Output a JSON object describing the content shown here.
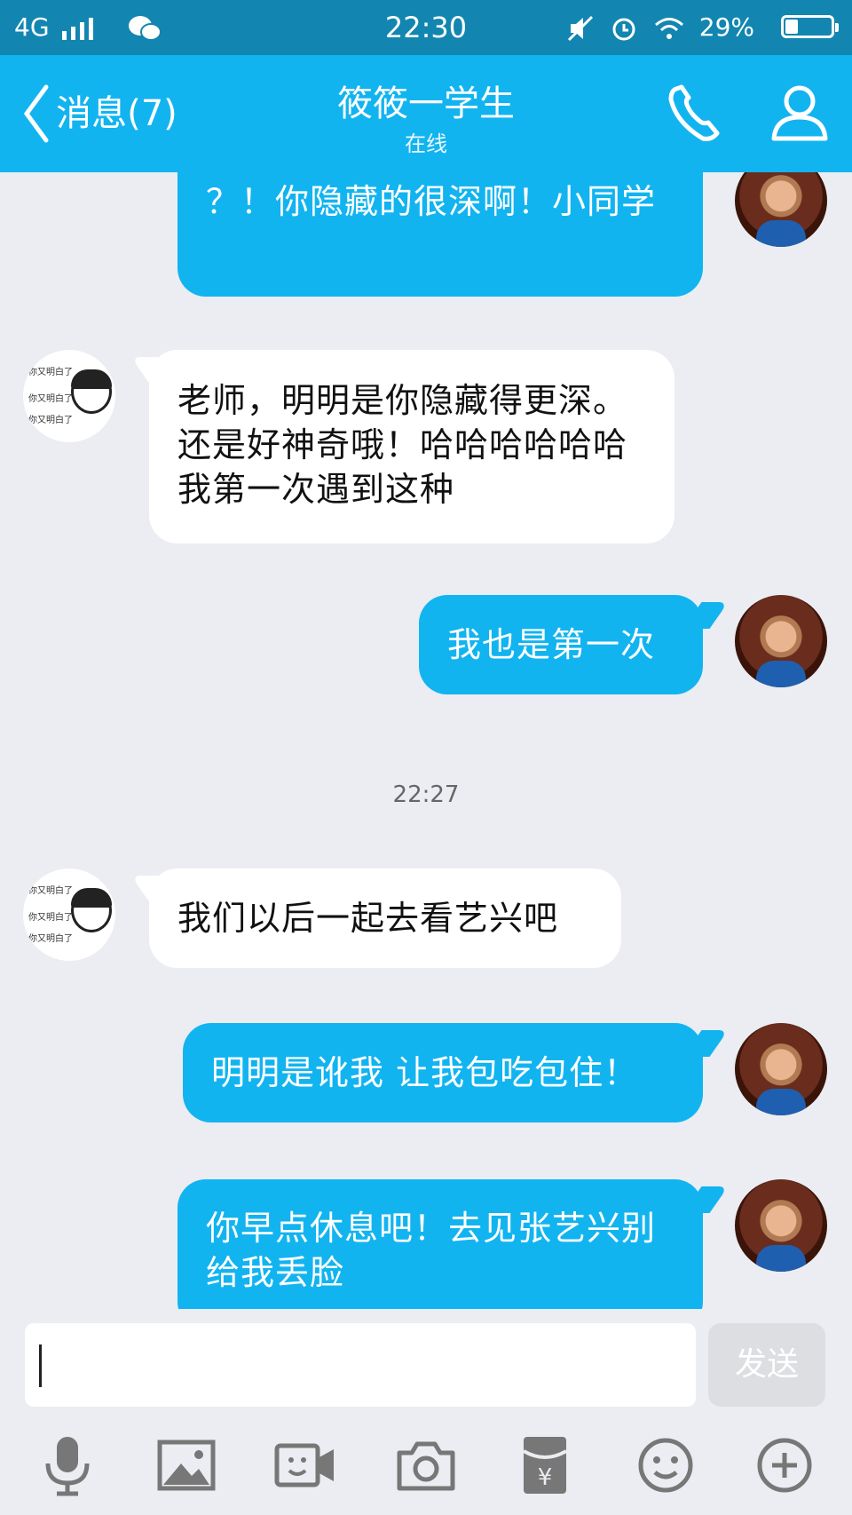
{
  "status_bar": {
    "network": "4G",
    "time": "22:30",
    "battery": "29%",
    "battery_level": 0.29
  },
  "header": {
    "back_label": "消息(7)",
    "title": "筱筱一学生",
    "subtitle": "在线"
  },
  "messages": [
    {
      "side": "out",
      "text": "？！你隐藏的很深啊！小同学"
    },
    {
      "side": "in",
      "text": "老师，明明是你隐藏得更深。还是好神奇哦！哈哈哈哈哈哈我第一次遇到这种"
    },
    {
      "side": "out",
      "text": "我也是第一次"
    },
    {
      "timestamp": "22:27"
    },
    {
      "side": "in",
      "text": "我们以后一起去看艺兴吧"
    },
    {
      "side": "out",
      "text": "明明是讹我 让我包吃包住！"
    },
    {
      "side": "out",
      "text": "你早点休息吧！去见张艺兴别给我丢脸"
    }
  ],
  "peer_avatar_text": "你又明白了",
  "input": {
    "value": "",
    "send_label": "发送"
  },
  "toolbar": [
    "microphone-icon",
    "image-icon",
    "video-icon",
    "camera-icon",
    "red-packet-icon",
    "emoji-icon",
    "plus-icon"
  ]
}
